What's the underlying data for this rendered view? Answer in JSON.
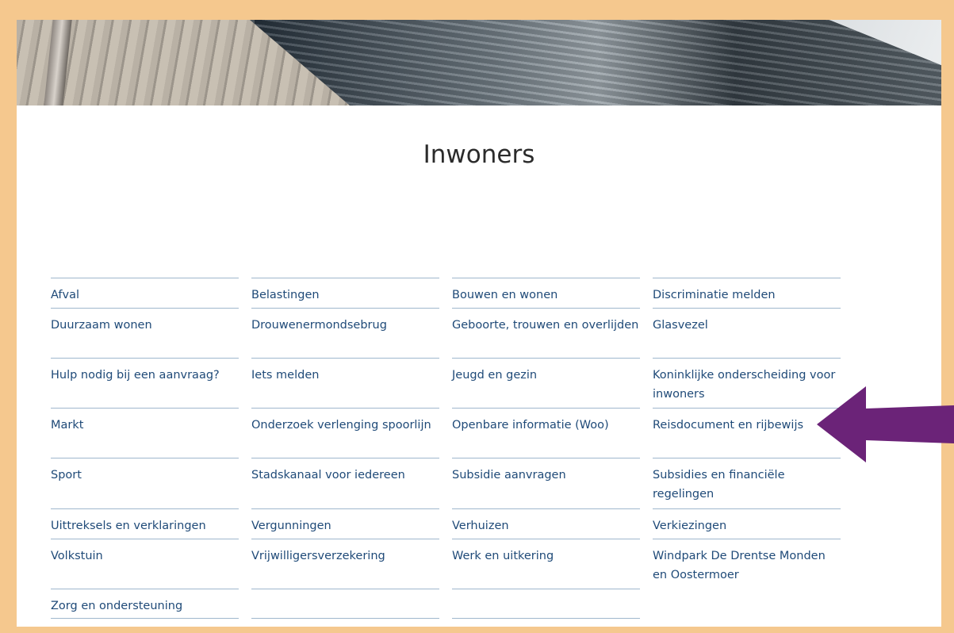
{
  "page": {
    "title": "Inwoners"
  },
  "links": [
    [
      "Afval",
      "Belastingen",
      "Bouwen en wonen",
      "Discriminatie melden"
    ],
    [
      "Duurzaam wonen",
      "Drouwenermondsebrug",
      "Geboorte, trouwen en overlijden",
      "Glasvezel"
    ],
    [
      "Hulp nodig bij een aanvraag?",
      "Iets melden",
      "Jeugd en gezin",
      "Koninklijke onderscheiding voor inwoners"
    ],
    [
      "Markt",
      "Onderzoek verlenging spoorlijn",
      "Openbare informatie (Woo)",
      "Reisdocument en rijbewijs"
    ],
    [
      "Sport",
      "Stadskanaal voor iedereen",
      "Subsidie aanvragen",
      "Subsidies en financiële regelingen"
    ],
    [
      "Uittreksels en verklaringen",
      "Vergunningen",
      "Verhuizen",
      "Verkiezingen"
    ],
    [
      "Volkstuin",
      "Vrijwilligersverzekering",
      "Werk en uitkering",
      "Windpark De Drentse Monden en Oostermoer"
    ],
    [
      "Zorg en ondersteuning"
    ]
  ],
  "annotation": {
    "arrow_color": "#6b2378",
    "points_to": "Reisdocument en rijbewijs"
  },
  "colors": {
    "frame": "#f5c88e",
    "link": "#1f4a78",
    "divider": "#9fb7cd"
  }
}
